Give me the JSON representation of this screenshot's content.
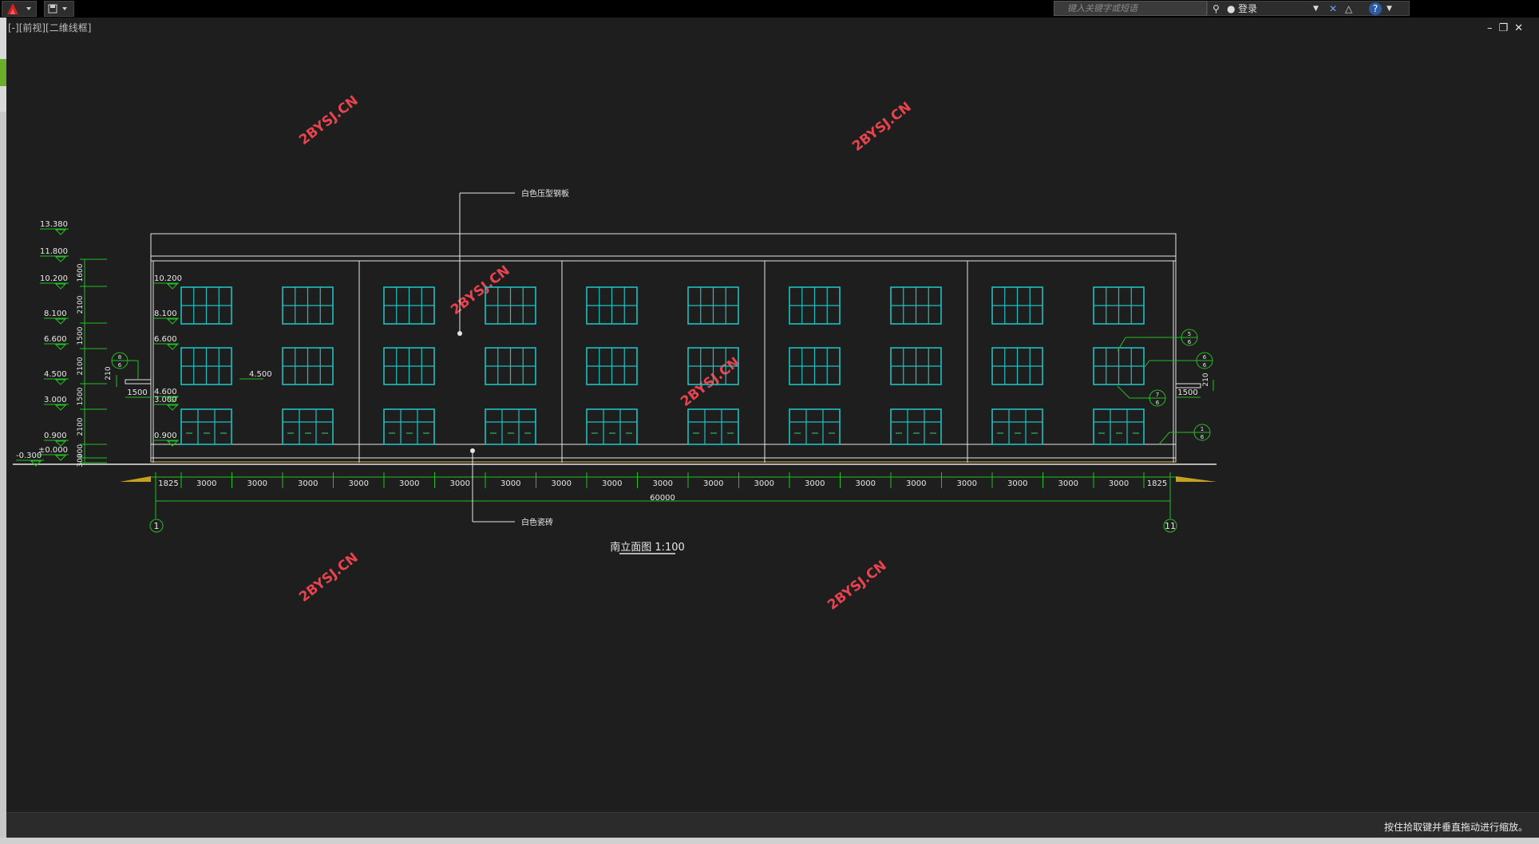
{
  "app": {
    "viewport_label": "[-][前视][二维线框]",
    "search_placeholder": "键入关键字或短语",
    "login_label": "登录",
    "help_label": "?",
    "status_text": "按住拾取键并垂直拖动进行缩放。"
  },
  "drawing": {
    "title": "南立面图 1:100",
    "annotation_top": "白色压型钢板",
    "annotation_bottom": "白色瓷砖",
    "watermark": "2BYSJ.CN",
    "overall_dimension": "60000",
    "grid_start": "1",
    "grid_end": "11",
    "bay_dimensions": [
      "1825",
      "3000",
      "3000",
      "3000",
      "3000",
      "3000",
      "3000",
      "3000",
      "3000",
      "3000",
      "3000",
      "3000",
      "3000",
      "3000",
      "3000",
      "3000",
      "3000",
      "3000",
      "3000",
      "3000",
      "1825"
    ],
    "left_elevations": [
      "13.380",
      "11.800",
      "10.200",
      "8.100",
      "6.600",
      "4.500",
      "3.000",
      "0.900",
      "±0.000",
      "-0.300"
    ],
    "inner_elevations": [
      "10.200",
      "8.100",
      "6.600",
      "4.600",
      "3.000",
      "0.900"
    ],
    "side_elevation": "4.500",
    "vertical_dims": [
      "1600",
      "2100",
      "1500",
      "2100",
      "1500",
      "2100",
      "900",
      "300"
    ],
    "side_dim_left": "1500",
    "side_dim_right": "1500",
    "side_210": "210",
    "detail_tags": [
      {
        "top": "8",
        "bottom": "6"
      },
      {
        "top": "5",
        "bottom": "6"
      },
      {
        "top": "6",
        "bottom": "6"
      },
      {
        "top": "7",
        "bottom": "6"
      },
      {
        "top": "1",
        "bottom": "6"
      }
    ]
  },
  "colors": {
    "building_line": "#e6e6e6",
    "window": "#1fc0c0",
    "dimension": "#22c022",
    "watermark": "#e8434e"
  }
}
